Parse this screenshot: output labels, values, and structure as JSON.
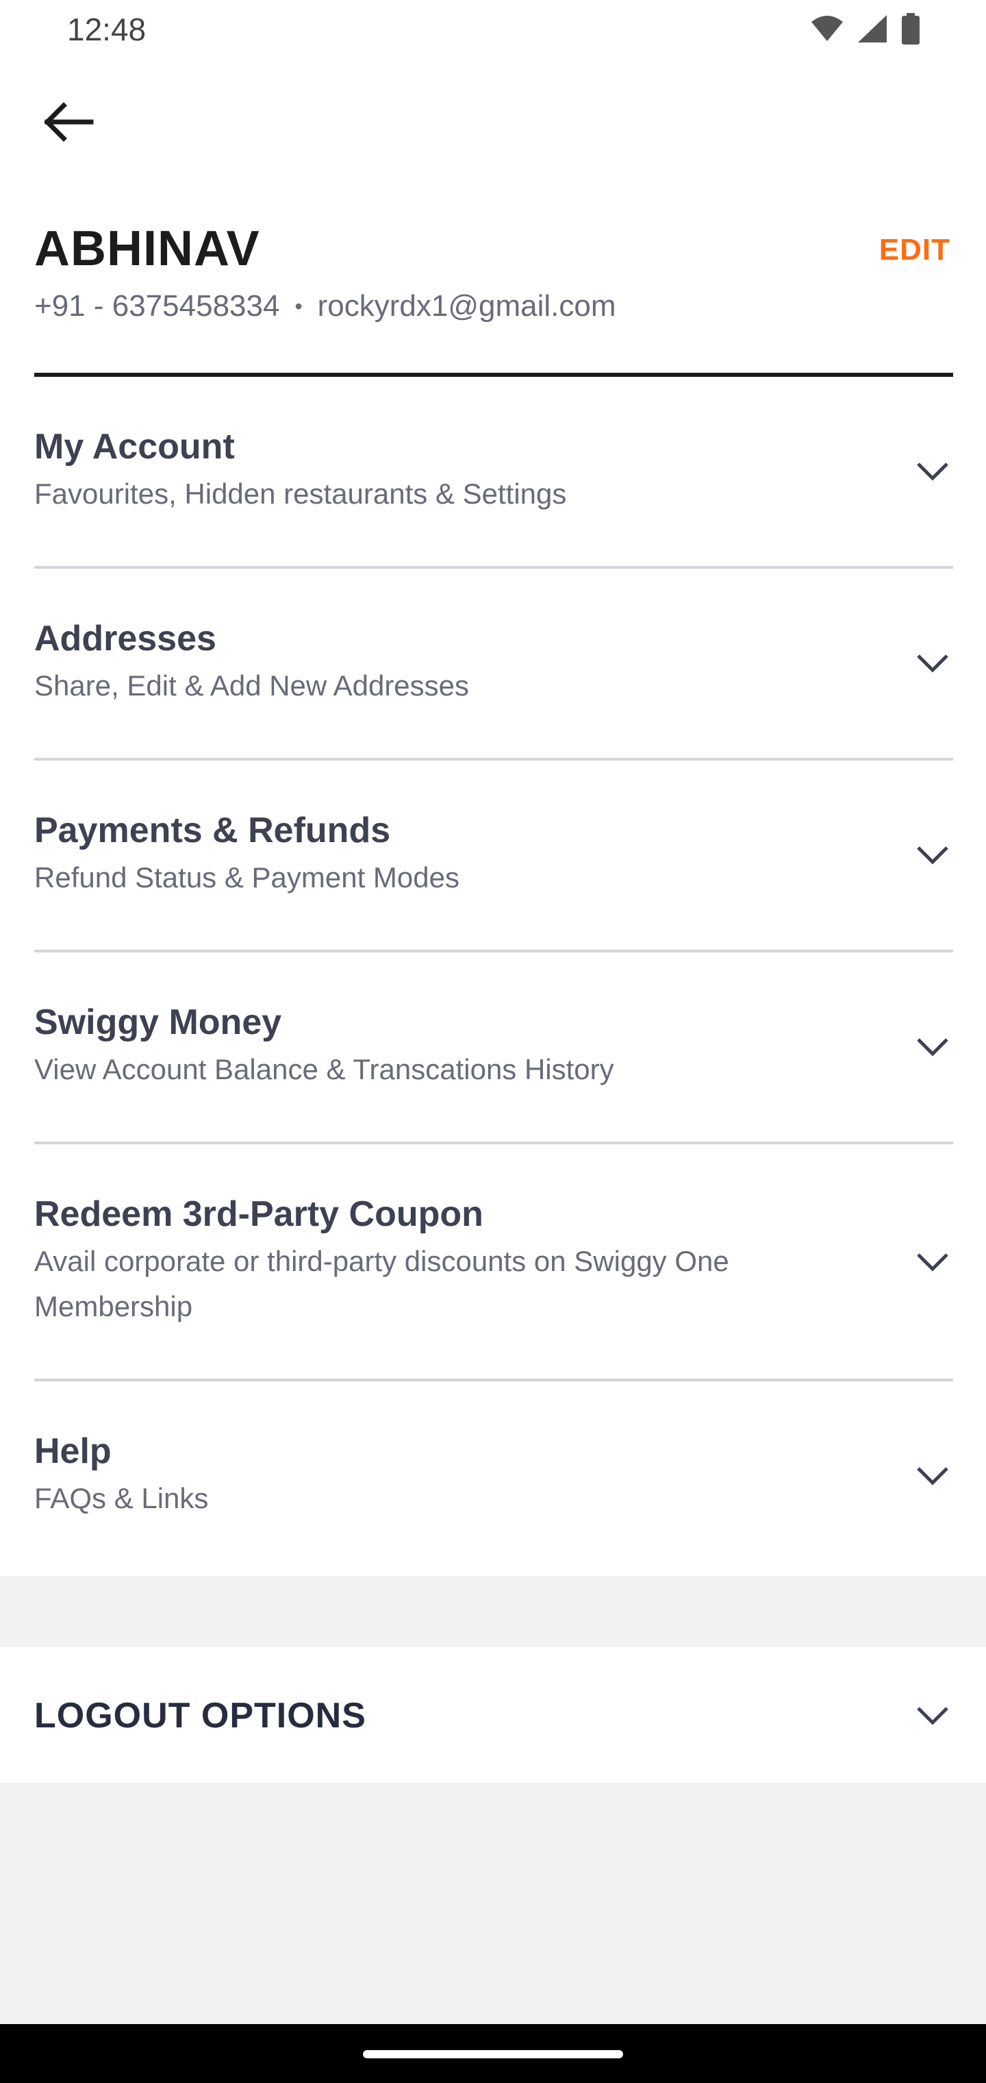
{
  "status_bar": {
    "time": "12:48",
    "icons": [
      "wifi-icon",
      "signal-icon",
      "battery-icon"
    ]
  },
  "header": {
    "back_icon": "arrow-left-icon"
  },
  "profile": {
    "name": "ABHINAV",
    "edit_label": "EDIT",
    "phone": "+91 - 6375458334",
    "separator": "•",
    "email": "rockyrdx1@gmail.com"
  },
  "menu": {
    "items": [
      {
        "title": "My Account",
        "subtitle": "Favourites, Hidden restaurants & Settings"
      },
      {
        "title": "Addresses",
        "subtitle": "Share, Edit & Add New Addresses"
      },
      {
        "title": "Payments & Refunds",
        "subtitle": "Refund Status & Payment Modes"
      },
      {
        "title": "Swiggy Money",
        "subtitle": "View Account Balance & Transcations History"
      },
      {
        "title": "Redeem 3rd-Party Coupon",
        "subtitle": "Avail corporate or third-party discounts on Swiggy One Membership"
      },
      {
        "title": "Help",
        "subtitle": "FAQs & Links"
      }
    ]
  },
  "logout": {
    "label": "LOGOUT OPTIONS"
  },
  "colors": {
    "accent": "#fc6d12",
    "title_text": "#3d4152",
    "subtitle_text": "#686b78",
    "divider": "#d4d5d9",
    "background_gray": "#f2f2f2"
  }
}
